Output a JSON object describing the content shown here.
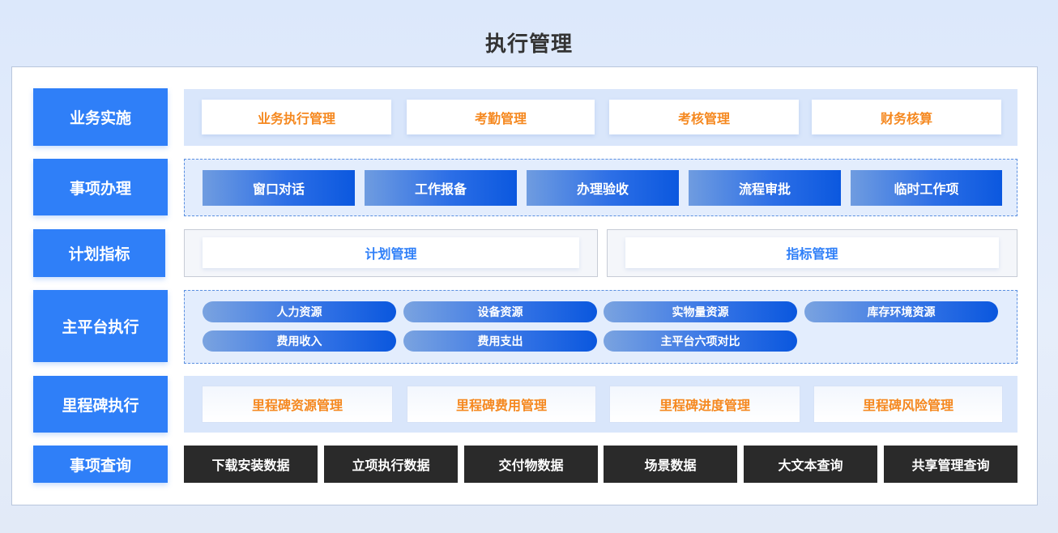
{
  "title": "执行管理",
  "rows": {
    "business": {
      "label": "业务实施",
      "items": [
        "业务执行管理",
        "考勤管理",
        "考核管理",
        "财务核算"
      ]
    },
    "matters": {
      "label": "事项办理",
      "items": [
        "窗口对话",
        "工作报备",
        "办理验收",
        "流程审批",
        "临时工作项"
      ]
    },
    "plan": {
      "label": "计划指标",
      "items": [
        "计划管理",
        "指标管理"
      ]
    },
    "platform": {
      "label": "主平台执行",
      "items": [
        "人力资源",
        "设备资源",
        "实物量资源",
        "库存环境资源",
        "费用收入",
        "费用支出",
        "主平台六项对比"
      ]
    },
    "milestone": {
      "label": "里程碑执行",
      "items": [
        "里程碑资源管理",
        "里程碑费用管理",
        "里程碑进度管理",
        "里程碑风险管理"
      ]
    },
    "query": {
      "label": "事项查询",
      "items": [
        "下载安装数据",
        "立项执行数据",
        "交付物数据",
        "场景数据",
        "大文本查询",
        "共享管理查询"
      ]
    }
  },
  "colors": {
    "label_blue": "#2f7ff8",
    "orange_text": "#f5881f",
    "dark_button": "#2a2a2a"
  }
}
